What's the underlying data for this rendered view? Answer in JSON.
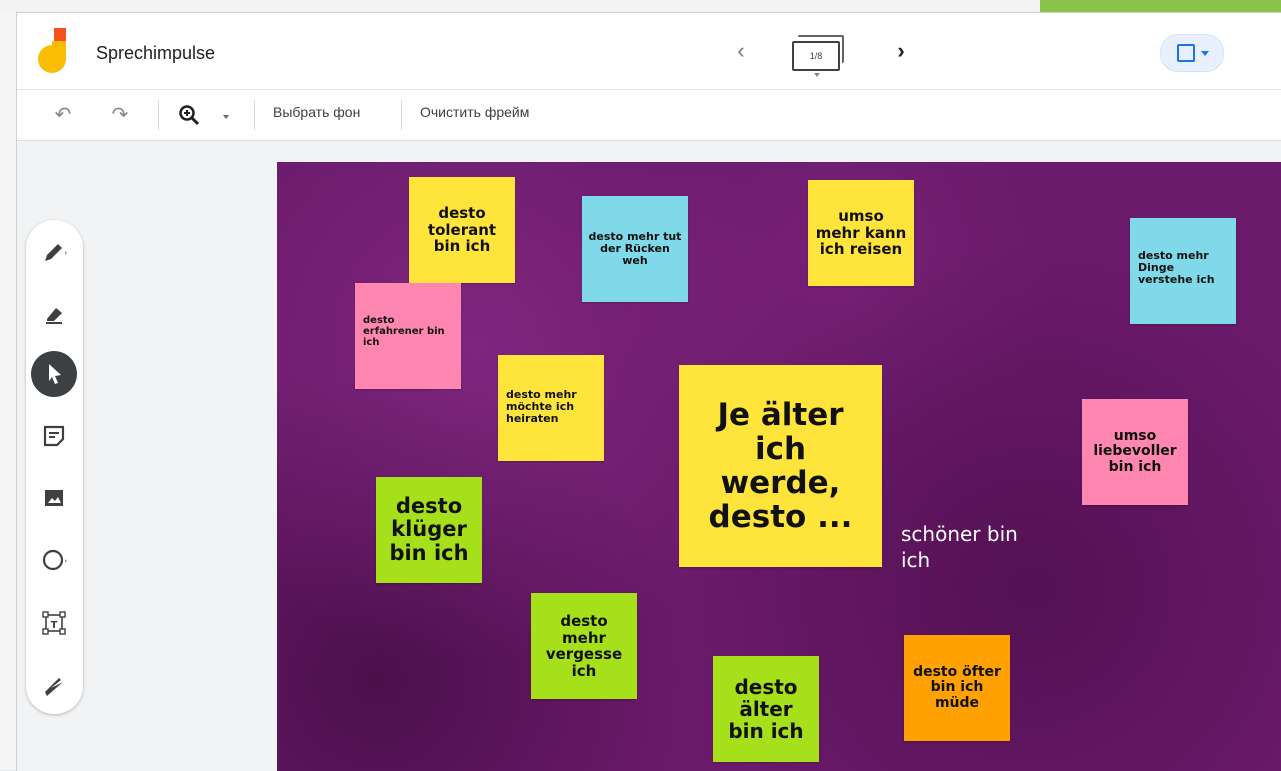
{
  "app": {
    "title": "Sprechimpulse",
    "frame_indicator": "1/8",
    "colors": {
      "accent": "#1a73e8",
      "canvas_bg": "#6b1a6b"
    }
  },
  "toolbar": {
    "undo_icon": "undo-icon",
    "redo_icon": "redo-icon",
    "zoom_icon": "zoom-in-icon",
    "set_background": "Выбрать фон",
    "clear_frame": "Очистить фрейм"
  },
  "tools": [
    "pen-icon",
    "eraser-icon",
    "select-arrow-icon",
    "sticky-note-icon",
    "image-icon",
    "circle-shape-icon",
    "text-box-icon",
    "laser-icon"
  ],
  "notes": [
    {
      "id": "tolerant",
      "text": "desto tolerant bin ich",
      "color": "yellow"
    },
    {
      "id": "ruecken",
      "text": "desto mehr tut der Rücken weh",
      "color": "blue"
    },
    {
      "id": "reisen",
      "text": "umso mehr kann ich reisen",
      "color": "yellow"
    },
    {
      "id": "dinge",
      "text": "desto mehr Dinge verstehe ich",
      "color": "blue"
    },
    {
      "id": "erfahrener",
      "text": "desto erfahrener bin ich",
      "color": "pink"
    },
    {
      "id": "heiraten",
      "text": "desto mehr möchte ich heiraten",
      "color": "yellow"
    },
    {
      "id": "main",
      "text": "Je älter ich werde, desto ...",
      "color": "yellow"
    },
    {
      "id": "liebevoller",
      "text": "umso liebevoller bin ich",
      "color": "pink"
    },
    {
      "id": "klueger",
      "text": "desto klüger bin ich",
      "color": "green"
    },
    {
      "id": "vergesse",
      "text": "desto mehr vergesse ich",
      "color": "green"
    },
    {
      "id": "aelter",
      "text": "desto älter bin ich",
      "color": "green"
    },
    {
      "id": "muede",
      "text": "desto öfter bin ich müde",
      "color": "orange"
    }
  ],
  "canvas_text": "schöner bin ich"
}
